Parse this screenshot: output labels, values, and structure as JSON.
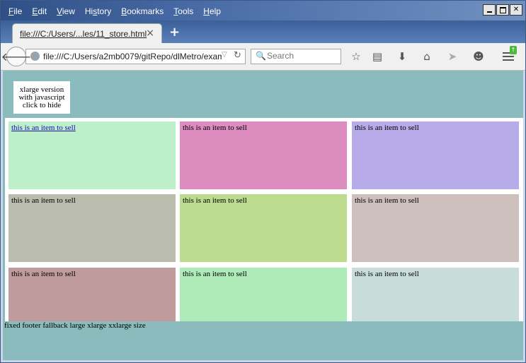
{
  "menubar": {
    "items": [
      {
        "ul": "F",
        "rest": "ile"
      },
      {
        "ul": "E",
        "rest": "dit"
      },
      {
        "ul": "V",
        "rest": "iew"
      },
      {
        "pre": "Hi",
        "ul": "s",
        "rest": "tory"
      },
      {
        "ul": "B",
        "rest": "ookmarks"
      },
      {
        "ul": "T",
        "rest": "ools"
      },
      {
        "ul": "H",
        "rest": "elp"
      }
    ]
  },
  "tab": {
    "title": "file:///C:/Users/...les/11_store.html",
    "close": "×"
  },
  "navbar": {
    "url": "file:///C:/Users/a2mb0079/gitRepo/dlMetro/examp",
    "search_placeholder": "Search"
  },
  "page": {
    "xlarge_lines": [
      "xlarge version",
      "with javascript",
      "click to hide"
    ],
    "items": [
      {
        "text": "this is an item to sell",
        "color": "#bdefcb",
        "link": true
      },
      {
        "text": "this is an item to sell",
        "color": "#dd8cbf",
        "link": false
      },
      {
        "text": "this is an item to sell",
        "color": "#b8abe9",
        "link": false
      },
      {
        "text": "this is an item to sell",
        "color": "#babdae",
        "link": false
      },
      {
        "text": "this is an item to sell",
        "color": "#bddb8e",
        "link": false
      },
      {
        "text": "this is an item to sell",
        "color": "#cdbfbb",
        "link": false
      },
      {
        "text": "this is an item to sell",
        "color": "#bf9b9d",
        "link": false
      },
      {
        "text": "this is an item to sell",
        "color": "#aeebb8",
        "link": false
      },
      {
        "text": "this is an item to sell",
        "color": "#c8ddda",
        "link": false
      }
    ],
    "footer": "fixed footer fallback large xlarge xxlarge size"
  }
}
